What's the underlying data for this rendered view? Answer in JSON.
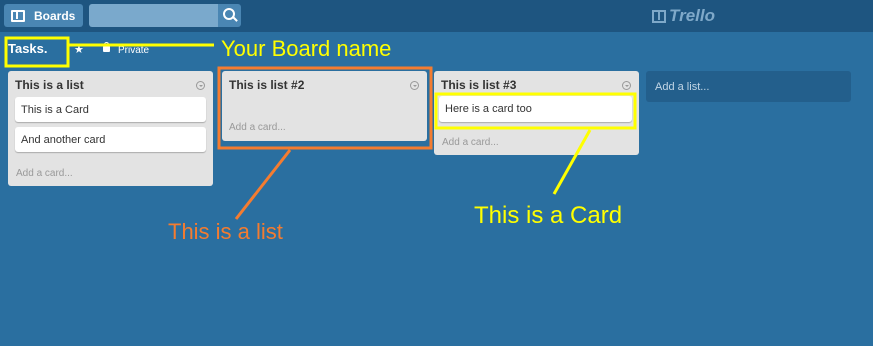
{
  "header": {
    "boards_label": "Boards",
    "search_value": "",
    "search_placeholder": "",
    "logo_text": "Trello",
    "icons": [
      "boards-icon",
      "search-icon",
      "trello-logo-icon"
    ]
  },
  "board": {
    "title": "Tasks.",
    "visibility": "Private",
    "icons": [
      "star-icon",
      "lock-icon"
    ]
  },
  "lists": [
    {
      "title": "This is a list",
      "cards": [
        "This is a Card",
        "And another card"
      ],
      "add_card": "Add a card..."
    },
    {
      "title": "This is list #2",
      "cards": [],
      "add_card": "Add a card..."
    },
    {
      "title": "This is list #3",
      "cards": [
        "Here is a card too"
      ],
      "add_card": "Add a card..."
    }
  ],
  "add_list": "Add a list...",
  "annotations": {
    "board_name": "Your Board name",
    "list": "This is a list",
    "card": "This is a Card"
  },
  "colors": {
    "background": "#2a6fa0",
    "topbar": "#1e5580",
    "list_bg": "#e3e3e3",
    "annotation_yellow": "#ffff00",
    "annotation_orange": "#f47c30"
  }
}
